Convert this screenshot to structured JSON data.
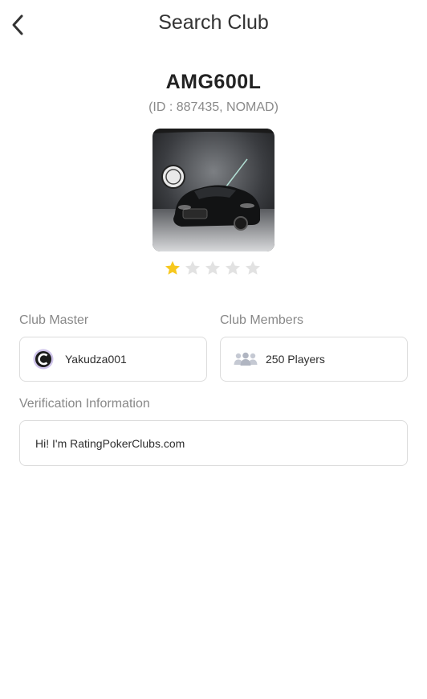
{
  "header": {
    "title": "Search Club"
  },
  "club": {
    "name": "AMG600L",
    "id_line": "(ID : 887435, NOMAD)",
    "rating": 1,
    "rating_max": 5
  },
  "master": {
    "label": "Club Master",
    "value": "Yakudza001"
  },
  "members": {
    "label": "Club Members",
    "value": "250 Players"
  },
  "verification": {
    "label": "Verification Information",
    "value": "Hi! I'm RatingPokerClubs.com"
  },
  "colors": {
    "star_active": "#f7c81e",
    "star_inactive": "#e2e2e2",
    "border": "#dcdcdc"
  },
  "icons": {
    "back": "chevron-left-icon",
    "master": "avatar-icon",
    "members": "people-icon"
  }
}
